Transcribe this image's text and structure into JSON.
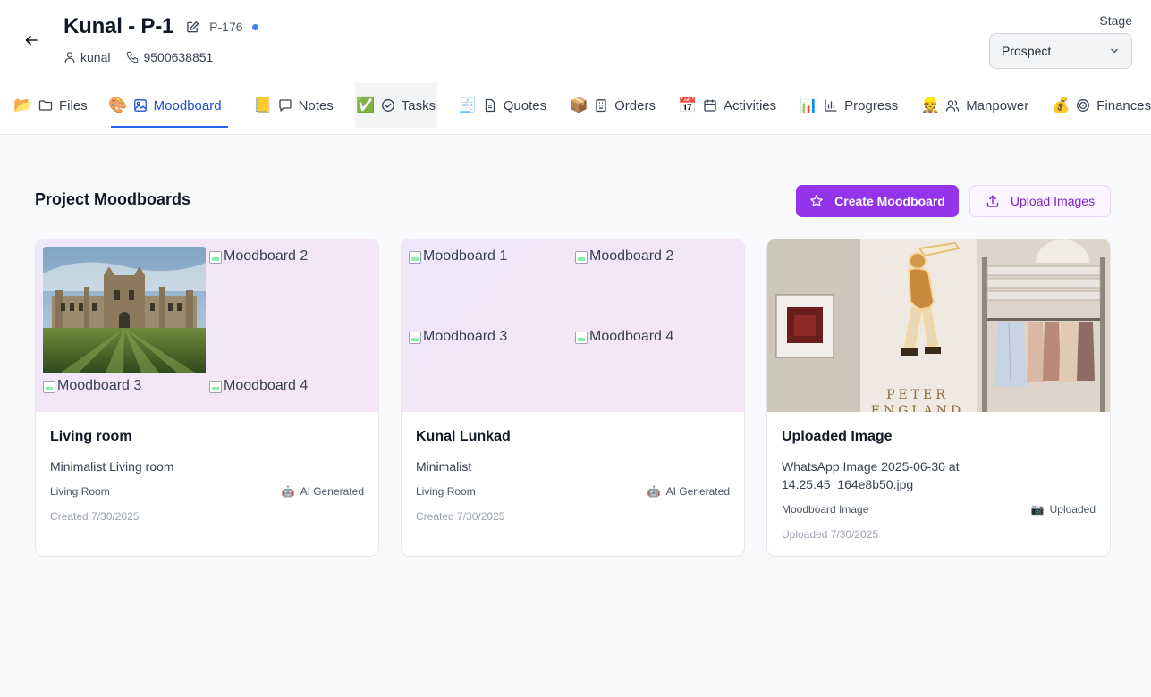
{
  "header": {
    "title": "Kunal - P-1",
    "code": "P-176",
    "user": "kunal",
    "phone": "9500638851",
    "stage_label": "Stage",
    "stage_value": "Prospect"
  },
  "tabs": [
    {
      "emoji": "📂",
      "icon": "folder-icon",
      "label": "Files"
    },
    {
      "emoji": "🎨",
      "icon": "image-icon",
      "label": "Moodboard",
      "active": true
    },
    {
      "emoji": "📒",
      "icon": "message-icon",
      "label": "Notes"
    },
    {
      "emoji": "✅",
      "icon": "check-circle-icon",
      "label": "Tasks"
    },
    {
      "emoji": "🧾",
      "icon": "document-icon",
      "label": "Quotes"
    },
    {
      "emoji": "📦",
      "icon": "building-icon",
      "label": "Orders"
    },
    {
      "emoji": "📅",
      "icon": "calendar-icon",
      "label": "Activities"
    },
    {
      "emoji": "📊",
      "icon": "bar-chart-icon",
      "label": "Progress"
    },
    {
      "emoji": "👷",
      "icon": "users-icon",
      "label": "Manpower"
    },
    {
      "emoji": "💰",
      "icon": "target-icon",
      "label": "Finances"
    }
  ],
  "main": {
    "section_title": "Project Moodboards",
    "create_label": "Create Moodboard",
    "upload_label": "Upload Images"
  },
  "cards": [
    {
      "title": "Living room",
      "description": "Minimalist Living room",
      "room": "Living Room",
      "badge": "AI Generated",
      "badge_emoji": "🤖",
      "date": "Created 7/30/2025",
      "thumbs": [
        "Moodboard 2",
        "Moodboard 3",
        "Moodboard 4"
      ]
    },
    {
      "title": "Kunal Lunkad",
      "description": "Minimalist",
      "room": "Living Room",
      "badge": "AI Generated",
      "badge_emoji": "🤖",
      "date": "Created 7/30/2025",
      "thumbs": [
        "Moodboard 1",
        "Moodboard 2",
        "Moodboard 3",
        "Moodboard 4"
      ]
    },
    {
      "title": "Uploaded Image",
      "description": "WhatsApp Image 2025-06-30 at 14.25.45_164e8b50.jpg",
      "room": "Moodboard Image",
      "badge": "Uploaded",
      "badge_emoji": "📷",
      "date": "Uploaded 7/30/2025",
      "image_text": "PETER ENGLAND"
    }
  ]
}
